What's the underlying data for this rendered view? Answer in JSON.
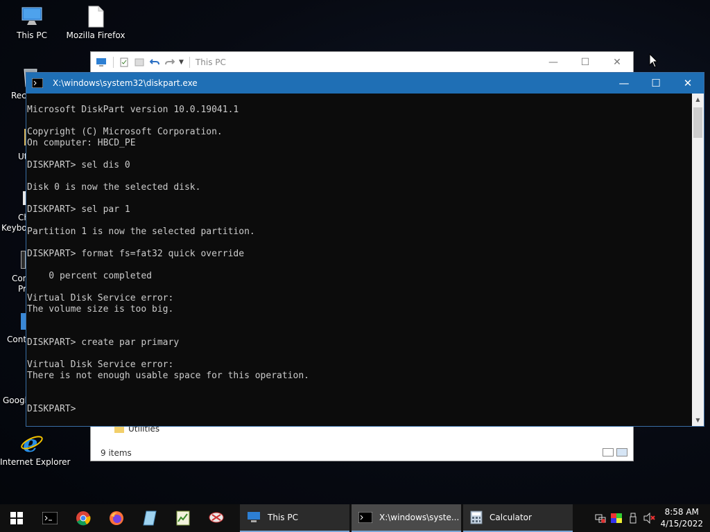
{
  "desktop": {
    "icons": [
      {
        "label": "This PC",
        "icon": "this-pc-icon"
      },
      {
        "label": "Mozilla Firefox",
        "icon": "file-icon"
      },
      {
        "label": "Internet Explorer",
        "icon": "internet-explorer-icon"
      }
    ],
    "partial_labels": [
      "Recy",
      "Ut",
      "Ch",
      "Keyboa",
      "Con",
      "Pr",
      "Cont",
      "Googl"
    ]
  },
  "explorer": {
    "title": "This PC",
    "visible_item": "Utilities",
    "status": "9 items"
  },
  "console": {
    "title": "X:\\windows\\system32\\diskpart.exe",
    "lines": [
      "Microsoft DiskPart version 10.0.19041.1",
      "",
      "Copyright (C) Microsoft Corporation.",
      "On computer: HBCD_PE",
      "",
      "DISKPART> sel dis 0",
      "",
      "Disk 0 is now the selected disk.",
      "",
      "DISKPART> sel par 1",
      "",
      "Partition 1 is now the selected partition.",
      "",
      "DISKPART> format fs=fat32 quick override",
      "",
      "    0 percent completed",
      "",
      "Virtual Disk Service error:",
      "The volume size is too big.",
      "",
      "",
      "DISKPART> create par primary",
      "",
      "Virtual Disk Service error:",
      "There is not enough usable space for this operation.",
      "",
      "",
      "DISKPART> "
    ]
  },
  "taskbar": {
    "pinned": [
      "start-icon",
      "command-prompt-icon",
      "chrome-icon",
      "firefox-icon",
      "notepad-icon",
      "task-manager-icon",
      "snipping-tool-icon"
    ],
    "tasks": [
      {
        "label": "This PC",
        "icon": "this-pc-icon",
        "active": false
      },
      {
        "label": "X:\\windows\\syste...",
        "icon": "console-icon",
        "active": true
      },
      {
        "label": "Calculator",
        "icon": "calculator-icon",
        "active": false
      }
    ],
    "tray": [
      "network-icon",
      "color-icon",
      "usb-icon",
      "volume-muted-icon"
    ],
    "time": "8:58 AM",
    "date": "4/15/2022"
  },
  "colors": {
    "console_titlebar": "#1f6fb5",
    "console_bg": "#0c0c0c",
    "console_text": "#cccccc",
    "taskbar": "#101010"
  }
}
